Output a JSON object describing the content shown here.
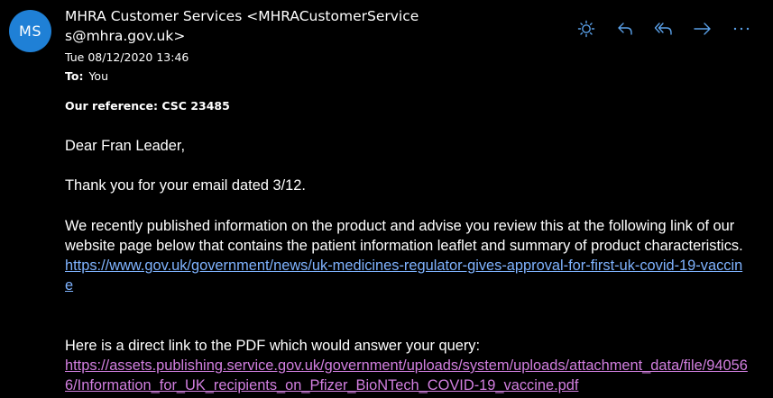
{
  "header": {
    "avatar_initials": "MS",
    "sender_line1": "MHRA Customer Services <MHRACustomerService",
    "sender_line2": "s@mhra.gov.uk>",
    "date": "Tue 08/12/2020 13:46",
    "to_label": "To:",
    "to_value": "You"
  },
  "toolbar": {
    "icons": [
      "sun-icon",
      "reply-icon",
      "reply-all-icon",
      "forward-icon",
      "more-icon"
    ]
  },
  "body": {
    "reference": "Our reference: CSC 23485",
    "greeting": "Dear Fran Leader,",
    "thanks": "Thank you for your email dated 3/12.",
    "info": "We recently published information on the product and advise you review this at the following link of our website page below that contains the patient information leaflet and summary of product characteristics.",
    "link1": "https://www.gov.uk/government/news/uk-medicines-regulator-gives-approval-for-first-uk-covid-19-vaccine",
    "direct": "Here is a direct link to the PDF which would answer your query:",
    "link2": "https://assets.publishing.service.gov.uk/government/uploads/system/uploads/attachment_data/file/940566/Information_for_UK_recipients_on_Pfizer_BioNTech_COVID-19_vaccine.pdf"
  },
  "colors": {
    "avatar_bg": "#1f80d6",
    "icon": "#5aa0e8",
    "link_unvisited": "#7fb3ff",
    "link_visited": "#d27fe0",
    "background": "#000000"
  }
}
